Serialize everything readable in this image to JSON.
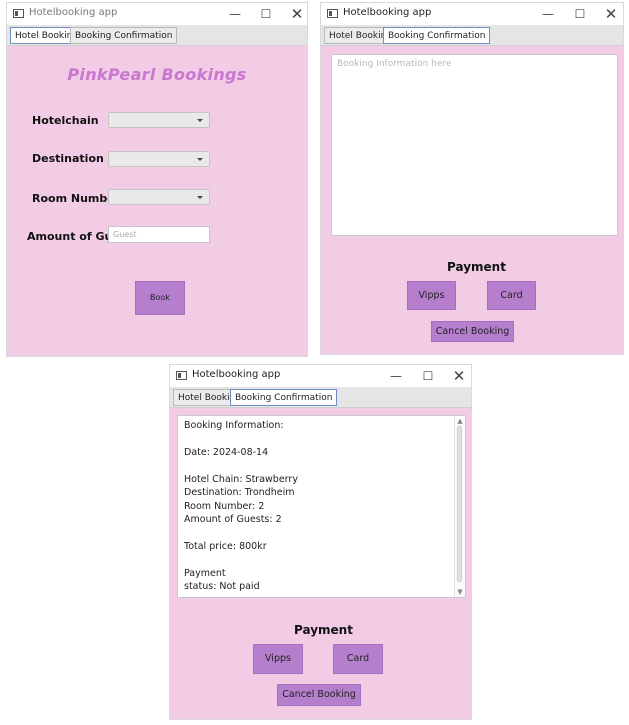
{
  "window1": {
    "title": "Hotelbooking app",
    "tabs": [
      "Hotel Booking",
      "Booking Confirmation"
    ],
    "brand": "PinkPearl Bookings",
    "fields": {
      "hotelchain": "Hotelchain",
      "destination": "Destination",
      "room_number": "Room Number",
      "amount_of_guests": "Amount of Gu..."
    },
    "guest_placeholder": "Guest",
    "book_label": "Book"
  },
  "window2": {
    "title": "Hotelbooking app",
    "tabs": [
      "Hotel Booking",
      "Booking Confirmation"
    ],
    "placeholder": "Booking Information here",
    "payment_title": "Payment",
    "vipps_label": "Vipps",
    "card_label": "Card",
    "cancel_label": "Cancel Booking"
  },
  "window3": {
    "title": "Hotelbooking app",
    "tabs": [
      "Hotel Booking",
      "Booking Confirmation"
    ],
    "info_lines": [
      "Booking Information:",
      "Date: 2024-08-14",
      "Hotel Chain: Strawberry",
      "Destination: Trondheim",
      "Room Number: 2",
      "Amount of Guests: 2",
      "Total price: 800kr",
      "Payment",
      "status: Not paid"
    ],
    "payment_title": "Payment",
    "vipps_label": "Vipps",
    "card_label": "Card",
    "cancel_label": "Cancel Booking"
  },
  "window_controls": {
    "minimize": "—",
    "maximize": "☐",
    "close": "✕"
  },
  "colors": {
    "window_bg": "#f2cce5",
    "button": "#b67fcd",
    "brand": "#c876cf",
    "active_tab_border": "#6f8fc2"
  }
}
